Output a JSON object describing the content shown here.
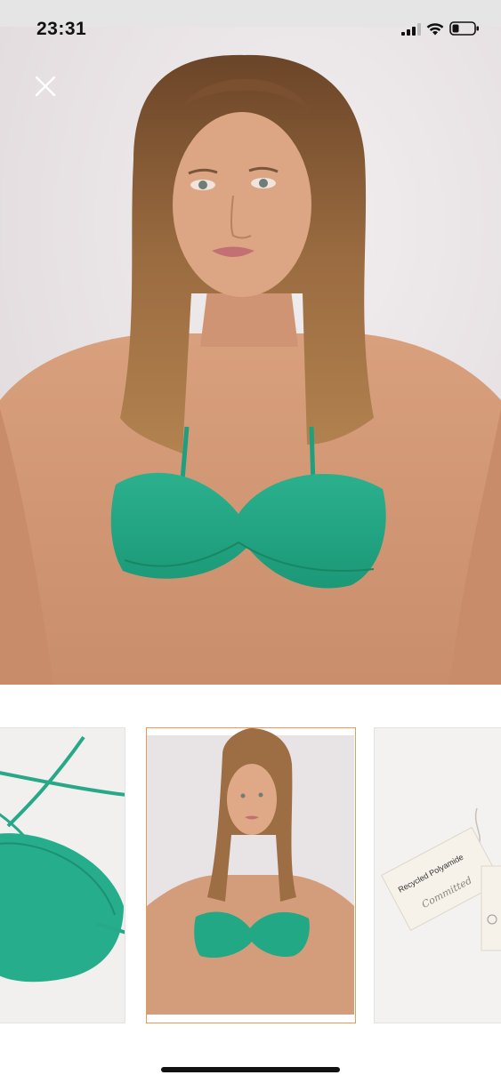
{
  "status_bar": {
    "time": "23:31",
    "icons": [
      "signal-icon",
      "wifi-icon",
      "battery-icon"
    ]
  },
  "viewer": {
    "close_icon": "close-icon",
    "main_image": "product-photo-model-green-bikini-top",
    "colors": {
      "accent_border": "#e69a5d",
      "garment": "#22a884"
    }
  },
  "thumbnails": [
    {
      "name": "thumbnail-flat-lay",
      "selected": false
    },
    {
      "name": "thumbnail-model",
      "selected": true
    },
    {
      "name": "thumbnail-tag",
      "selected": false,
      "tag_text": "Recycled Polyamide",
      "brand_script": "Committed"
    }
  ]
}
